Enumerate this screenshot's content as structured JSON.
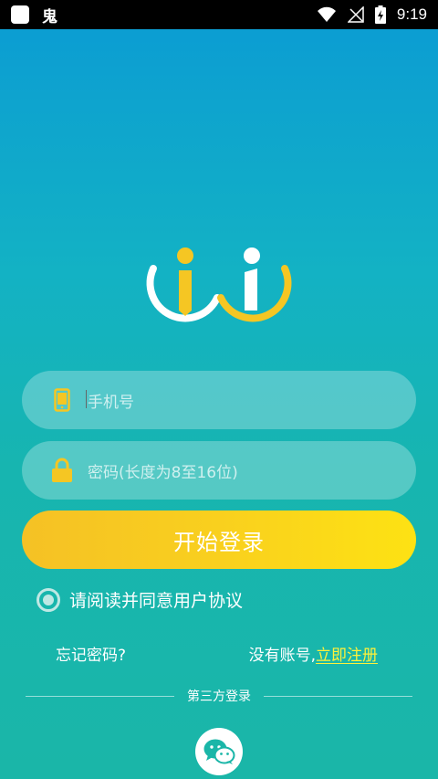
{
  "status_bar": {
    "app_glyph": "鬼",
    "time": "9:19",
    "icons": [
      "app-square-icon",
      "wifi-icon",
      "no-signal-icon",
      "battery-charging-icon"
    ]
  },
  "logo": {
    "icon": "wi-logo-icon",
    "colors": {
      "yellow": "#f5c623",
      "white": "#ffffff"
    }
  },
  "form": {
    "phone": {
      "placeholder": "手机号",
      "icon": "phone-icon"
    },
    "password": {
      "placeholder": "密码(长度为8至16位)",
      "icon": "lock-icon"
    },
    "login_label": "开始登录"
  },
  "agreement": {
    "text": "请阅读并同意用户协议",
    "checked": true
  },
  "links": {
    "forgot": "忘记密码?",
    "no_account": "没有账号,",
    "register": "立即注册"
  },
  "third_party": {
    "label": "第三方登录",
    "providers": [
      "wechat-icon"
    ]
  },
  "colors": {
    "accent": "#f9d01e",
    "link": "#fff23a"
  }
}
